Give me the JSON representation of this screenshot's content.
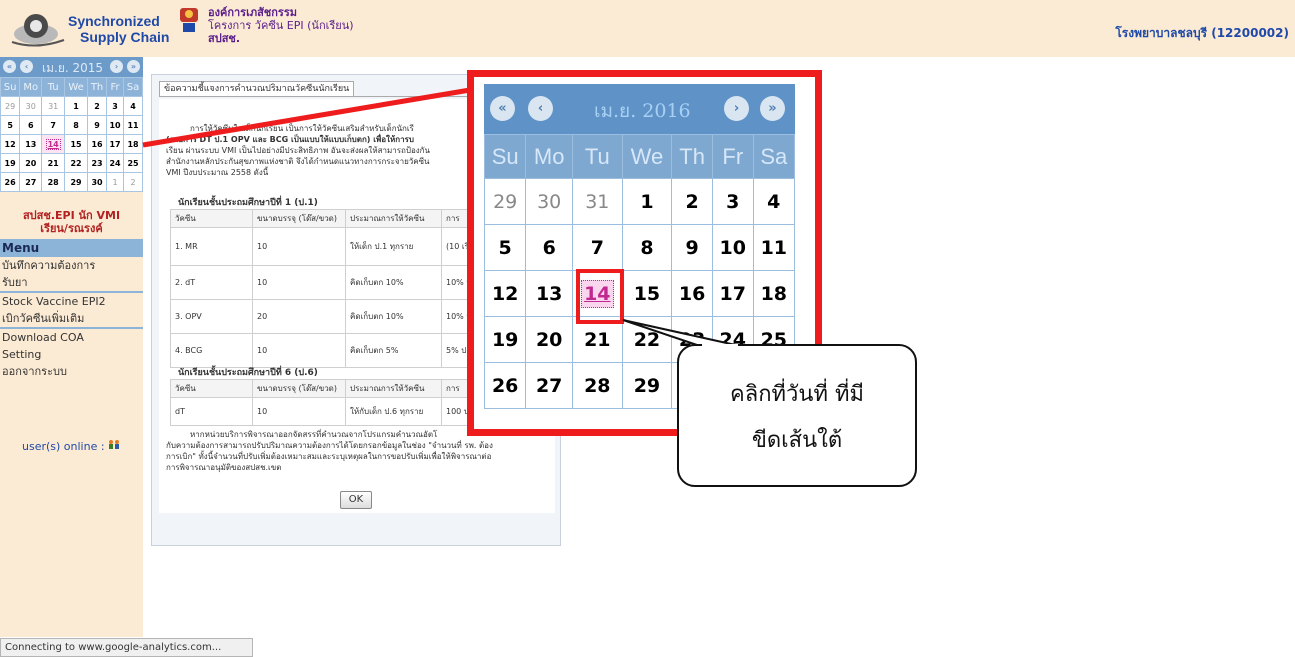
{
  "header": {
    "logo_line1": "Synchronized",
    "logo_line2": "Supply Chain",
    "org_line1": "องค์การเภสัชกรรม",
    "org_line2": "โครงการ วัคซีน EPI (นักเรียน)",
    "org_line3": "สปสช.",
    "hospital": "โรงพยาบาลชลบุรี (12200002)"
  },
  "mini_calendar": {
    "title": "เม.ย. 2015",
    "weekdays": [
      "Su",
      "Mo",
      "Tu",
      "We",
      "Th",
      "Fr",
      "Sa"
    ],
    "weeks": [
      [
        "29",
        "30",
        "31",
        "1",
        "2",
        "3",
        "4"
      ],
      [
        "5",
        "6",
        "7",
        "8",
        "9",
        "10",
        "11"
      ],
      [
        "12",
        "13",
        "14",
        "15",
        "16",
        "17",
        "18"
      ],
      [
        "19",
        "20",
        "21",
        "22",
        "23",
        "24",
        "25"
      ],
      [
        "26",
        "27",
        "28",
        "29",
        "30",
        "1",
        "2"
      ]
    ],
    "today": "14"
  },
  "sidebar": {
    "epi_line1": "สปสช.EPI นัก VMI",
    "epi_line2": "เรียน/รณรงค์",
    "menu_title": "Menu",
    "menu_items": [
      "บันทึกความต้องการ",
      "รับยา",
      "Stock Vaccine EPI2",
      "เบิกวัคซีนเพิ่มเติม",
      "Download COA",
      "Setting",
      "ออกจากระบบ"
    ],
    "online": "user(s) online :"
  },
  "panel": {
    "tab": "ข้อความชี้แจงการคำนวณปริมาณวัคซีนนักเรียน",
    "para_line1": "การให้วัคซีนในเด็กนักเรียน เป็นการให้วัคซีนเสริมสำหรับเด็กนักเรี",
    "para_line2": "(รายการ DT ป.1 OPV และ BCG เป็นแบบให้แบบเก็บตก) เพื่อให้การบ",
    "para_line3": "เรียน ผ่านระบบ VMI เป็นไปอย่างมีประสิทธิภาพ อันจะส่งผลให้สามารถป้องกัน",
    "para_line4": "สำนักงานหลักประกันสุขภาพแห่งชาติ จึงได้กำหนดแนวทางการกระจายวัคซีน",
    "para_line5": "VMI ปีงบประมาณ 2558 ดังนี้",
    "section1": "นักเรียนชั้นประถมศึกษาปีที่ 1 (ป.1)",
    "section2": "นักเรียนชั้นประถมศึกษาปีที่ 6 (ป.6)",
    "col_vaccine": "วัคซีน",
    "col_pack": "ขนาดบรรจุ (โด๊ส/ขวด)",
    "col_estimate": "ประมาณการให้วัคซีน",
    "col_more": "การ",
    "rows1": [
      {
        "vaccine": "1. MR",
        "pack": "10",
        "estimate": "ให้เด็ก ป.1 ทุกราย",
        "more": "(10 เรีย On"
      },
      {
        "vaccine": "2. dT",
        "pack": "10",
        "estimate": "คิดเก็บตก 10%",
        "more": "10% ป.1"
      },
      {
        "vaccine": "3. OPV",
        "pack": "20",
        "estimate": "คิดเก็บตก 10%",
        "more": "10% ป.1"
      },
      {
        "vaccine": "4. BCG",
        "pack": "10",
        "estimate": "คิดเก็บตก 5%",
        "more": "5% ป.1"
      }
    ],
    "rows2": [
      {
        "vaccine": "dT",
        "pack": "10",
        "estimate": "ให้กับเด็ก ป.6 ทุกราย",
        "more": "100 ป.6"
      }
    ],
    "note_line1": "หากหน่วยบริการพิจารณาออกจัดสรรที่คำนวณจากโปรแกรมคำนวณอัตโ",
    "note_line2": "กับความต้องการสามารถปรับปริมาณความต้องการได้โดยกรอกข้อมูลในช่อง \"จำนวนที่ รพ. ต้อง",
    "note_line3": "การเบิก\" ทั้งนี้จำนวนที่ปรับเพิ่มต้องเหมาะสมและระบุเหตุผลในการขอปรับเพิ่มเพื่อให้พิจารณาต่อ",
    "note_line4": "การพิจารณาอนุมัติของสปสช.เขต",
    "ok": "OK"
  },
  "zoom_calendar": {
    "title": "เม.ย. 2016",
    "weekdays": [
      "Su",
      "Mo",
      "Tu",
      "We",
      "Th",
      "Fr",
      "Sa"
    ],
    "weeks": [
      [
        "29",
        "30",
        "31",
        "1",
        "2",
        "3",
        "4"
      ],
      [
        "5",
        "6",
        "7",
        "8",
        "9",
        "10",
        "11"
      ],
      [
        "12",
        "13",
        "14",
        "15",
        "16",
        "17",
        "18"
      ],
      [
        "19",
        "20",
        "21",
        "22",
        "23",
        "24",
        "25"
      ],
      [
        "26",
        "27",
        "28",
        "29",
        "",
        "",
        ""
      ]
    ],
    "today": "14"
  },
  "callout": {
    "line1": "คลิกที่วันที่ ที่มี",
    "line2": "ขีดเส้นใต้"
  },
  "status": "Connecting to www.google-analytics.com...",
  "colors": {
    "header_bg": "#fcebd4",
    "calendar_blue": "#6d9bc9",
    "highlight_red": "#ee1c1c",
    "today_pink": "#c2288f"
  }
}
